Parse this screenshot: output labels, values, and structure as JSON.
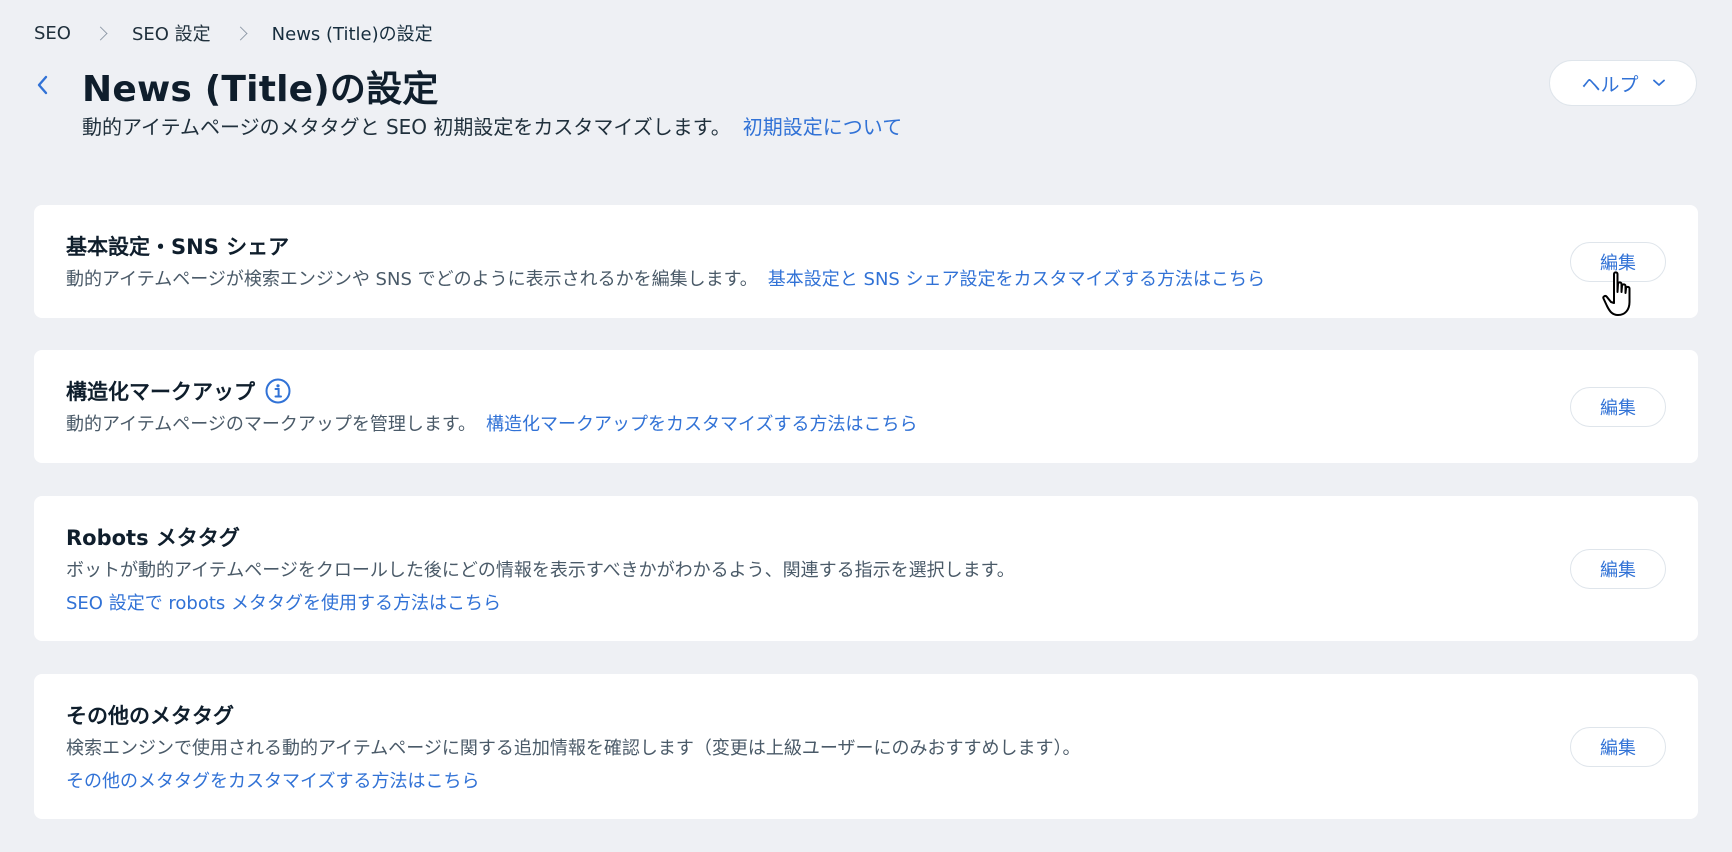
{
  "breadcrumb": [
    "SEO",
    "SEO 設定",
    "News (Title)の設定"
  ],
  "header": {
    "title": "News (Title)の設定",
    "subtitle": "動的アイテムページのメタタグと SEO 初期設定をカスタマイズします。",
    "subtitle_link": "初期設定について",
    "help_label": "ヘルプ"
  },
  "sections": [
    {
      "title": "基本設定・SNS シェア",
      "description": "動的アイテムページが検索エンジンや SNS でどのように表示されるかを編集します。",
      "link": "基本設定と SNS シェア設定をカスタマイズする方法はこちら",
      "edit_label": "編集"
    },
    {
      "title": "構造化マークアップ",
      "description": "動的アイテムページのマークアップを管理します。",
      "link": "構造化マークアップをカスタマイズする方法はこちら",
      "edit_label": "編集"
    },
    {
      "title": "Robots メタタグ",
      "description": "ボットが動的アイテムページをクロールした後にどの情報を表示すべきかがわかるよう、関連する指示を選択します。",
      "link": "SEO 設定で robots メタタグを使用する方法はこちら",
      "edit_label": "編集"
    },
    {
      "title": "その他のメタタグ",
      "description": "検索エンジンで使用される動的アイテムページに関する追加情報を確認します（変更は上級ユーザーにのみおすすめします）。",
      "link": "その他のメタタグをカスタマイズする方法はこちら",
      "edit_label": "編集"
    }
  ],
  "colors": {
    "background": "#eef0f4",
    "accent": "#3172d6",
    "card": "#ffffff",
    "title": "#0f1e2c"
  }
}
